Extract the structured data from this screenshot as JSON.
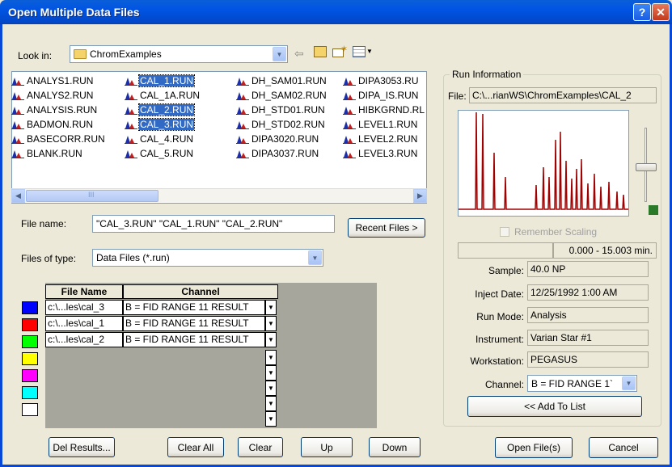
{
  "window": {
    "title": "Open Multiple Data Files",
    "help_label": "?",
    "close_label": "✕"
  },
  "look_in": {
    "label": "Look in:",
    "value": "ChromExamples"
  },
  "files": [
    {
      "name": "ANALYS1.RUN",
      "selected": false
    },
    {
      "name": "ANALYS2.RUN",
      "selected": false
    },
    {
      "name": "ANALYSIS.RUN",
      "selected": false
    },
    {
      "name": "BADMON.RUN",
      "selected": false
    },
    {
      "name": "BASECORR.RUN",
      "selected": false
    },
    {
      "name": "BLANK.RUN",
      "selected": false
    },
    {
      "name": "CAL_1.RUN",
      "selected": true
    },
    {
      "name": "CAL_1A.RUN",
      "selected": false
    },
    {
      "name": "CAL_2.RUN",
      "selected": true
    },
    {
      "name": "CAL_3.RUN",
      "selected": true
    },
    {
      "name": "CAL_4.RUN",
      "selected": false
    },
    {
      "name": "CAL_5.RUN",
      "selected": false
    },
    {
      "name": "DH_SAM01.RUN",
      "selected": false
    },
    {
      "name": "DH_SAM02.RUN",
      "selected": false
    },
    {
      "name": "DH_STD01.RUN",
      "selected": false
    },
    {
      "name": "DH_STD02.RUN",
      "selected": false
    },
    {
      "name": "DIPA3020.RUN",
      "selected": false
    },
    {
      "name": "DIPA3037.RUN",
      "selected": false
    },
    {
      "name": "DIPA3053.RU",
      "selected": false
    },
    {
      "name": "DIPA_IS.RUN",
      "selected": false
    },
    {
      "name": "HIBKGRND.RL",
      "selected": false
    },
    {
      "name": "LEVEL1.RUN",
      "selected": false
    },
    {
      "name": "LEVEL2.RUN",
      "selected": false
    },
    {
      "name": "LEVEL3.RUN",
      "selected": false
    }
  ],
  "scroll_thumb_text": "III",
  "file_name": {
    "label": "File name:",
    "value": "\"CAL_3.RUN\" \"CAL_1.RUN\" \"CAL_2.RUN\""
  },
  "recent_files_button": "Recent Files >",
  "files_of_type": {
    "label": "Files of type:",
    "value": "Data Files (*.run)"
  },
  "grid": {
    "col_file_name": "File Name",
    "col_channel": "Channel",
    "rows": [
      {
        "color": "#0000ff",
        "file": "c:\\...les\\cal_3",
        "channel": "B = FID RANGE 11 RESULT"
      },
      {
        "color": "#ff0000",
        "file": "c:\\...les\\cal_1",
        "channel": "B = FID RANGE 11 RESULT"
      },
      {
        "color": "#00ff00",
        "file": "c:\\...les\\cal_2",
        "channel": "B = FID RANGE 11 RESULT"
      }
    ],
    "empty_swatches": [
      "#ffff00",
      "#ff00ff",
      "#00ffff",
      "#ffffff"
    ]
  },
  "buttons": {
    "del_results": "Del Results...",
    "clear_all": "Clear All",
    "clear": "Clear",
    "up": "Up",
    "down": "Down",
    "open_files": "Open File(s)",
    "cancel": "Cancel",
    "add_to_list": "<< Add To List"
  },
  "run_info": {
    "group_title": "Run Information",
    "file_label": "File:",
    "file_value": "C:\\...rianWS\\ChromExamples\\CAL_2",
    "remember_scaling": "Remember Scaling",
    "range": "0.000 - 15.003 min.",
    "sample_label": "Sample:",
    "sample_value": "40.0 NP",
    "inject_date_label": "Inject Date:",
    "inject_date_value": "12/25/1992 1:00 AM",
    "run_mode_label": "Run Mode:",
    "run_mode_value": "Analysis",
    "instrument_label": "Instrument:",
    "instrument_value": "Varian Star #1",
    "workstation_label": "Workstation:",
    "workstation_value": "PEGASUS",
    "channel_label": "Channel:",
    "channel_value": "B = FID RANGE 1`"
  },
  "colors": {
    "title_bar": "#0054e3",
    "selection": "#316ac5",
    "trace": "#a00000"
  }
}
